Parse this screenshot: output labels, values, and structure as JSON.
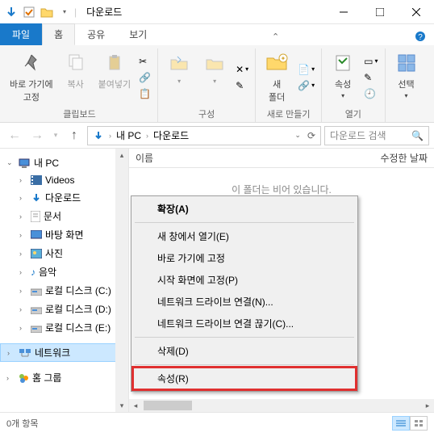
{
  "window": {
    "title": "다운로드"
  },
  "tabs": {
    "file": "파일",
    "home": "홈",
    "share": "공유",
    "view": "보기"
  },
  "ribbon": {
    "clipboard": {
      "label": "클립보드",
      "pin": "바로 가기에\n고정",
      "copy": "복사",
      "paste": "붙여넣기"
    },
    "organize": {
      "label": "구성"
    },
    "new": {
      "label": "새로 만들기",
      "newfolder": "새\n폴더"
    },
    "open": {
      "label": "열기",
      "properties": "속성"
    },
    "select": {
      "label": "선택",
      "select_btn": "선택"
    }
  },
  "address": {
    "segments": [
      "내 PC",
      "다운로드"
    ]
  },
  "search": {
    "placeholder": "다운로드 검색"
  },
  "tree": {
    "root": "내 PC",
    "items": [
      {
        "label": "Videos",
        "icon": "video"
      },
      {
        "label": "다운로드",
        "icon": "download"
      },
      {
        "label": "문서",
        "icon": "document"
      },
      {
        "label": "바탕 화면",
        "icon": "desktop"
      },
      {
        "label": "사진",
        "icon": "picture"
      },
      {
        "label": "음악",
        "icon": "music"
      },
      {
        "label": "로컬 디스크 (C:)",
        "icon": "disk"
      },
      {
        "label": "로컬 디스크 (D:)",
        "icon": "disk"
      },
      {
        "label": "로컬 디스크 (E:)",
        "icon": "disk"
      }
    ],
    "network": "네트워크",
    "homegroup": "홈 그룹"
  },
  "list": {
    "col_name": "이름",
    "col_modified": "수정한 날짜",
    "empty": "이 폴더는 비어 있습니다."
  },
  "context": {
    "expand": "확장(A)",
    "open_new": "새 창에서 열기(E)",
    "pin_quick": "바로 가기에 고정",
    "pin_start": "시작 화면에 고정(P)",
    "map_drive": "네트워크 드라이브 연결(N)...",
    "disconnect": "네트워크 드라이브 연결 끊기(C)...",
    "delete": "삭제(D)",
    "properties": "속성(R)"
  },
  "status": {
    "count": "0개 항목"
  }
}
